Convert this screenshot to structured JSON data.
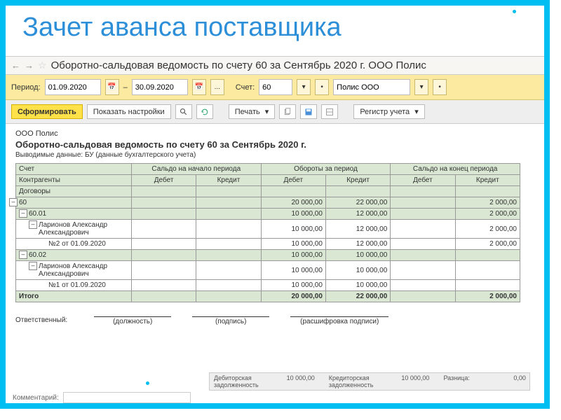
{
  "slide_title": "Зачет аванса поставщика",
  "window": {
    "title": "Оборотно-сальдовая ведомость по счету 60 за Сентябрь 2020 г. ООО Полис"
  },
  "filters": {
    "period_label": "Период:",
    "date_from": "01.09.2020",
    "date_dash": "–",
    "date_to": "30.09.2020",
    "account_label": "Счет:",
    "account": "60",
    "org": "Полис ООО"
  },
  "toolbar": {
    "form": "Сформировать",
    "settings": "Показать настройки",
    "print": "Печать",
    "register": "Регистр учета"
  },
  "report": {
    "org": "ООО Полис",
    "title": "Оборотно-сальдовая ведомость по счету 60 за Сентябрь 2020 г.",
    "subtitle": "Выводимые данные: БУ (данные бухгалтерского учета)",
    "headers": {
      "account": "Счет",
      "counterparties": "Контрагенты",
      "contracts": "Договоры",
      "start": "Сальдо на начало периода",
      "turnover": "Обороты за период",
      "end": "Сальдо на конец периода",
      "debit": "Дебет",
      "credit": "Кредит"
    },
    "rows": [
      {
        "name": "60",
        "sd": "",
        "sc": "",
        "td": "20 000,00",
        "tc": "22 000,00",
        "ed": "",
        "ec": "2 000,00",
        "cls": "gr",
        "ind": 0
      },
      {
        "name": "60.01",
        "sd": "",
        "sc": "",
        "td": "10 000,00",
        "tc": "12 000,00",
        "ed": "",
        "ec": "2 000,00",
        "cls": "gr",
        "ind": 1
      },
      {
        "name": "Ларионов Александр Александрович",
        "sd": "",
        "sc": "",
        "td": "10 000,00",
        "tc": "12 000,00",
        "ed": "",
        "ec": "2 000,00",
        "cls": "",
        "ind": 2
      },
      {
        "name": "№2 от 01.09.2020",
        "sd": "",
        "sc": "",
        "td": "10 000,00",
        "tc": "12 000,00",
        "ed": "",
        "ec": "2 000,00",
        "cls": "",
        "ind": 3
      },
      {
        "name": "60.02",
        "sd": "",
        "sc": "",
        "td": "10 000,00",
        "tc": "10 000,00",
        "ed": "",
        "ec": "",
        "cls": "gr",
        "ind": 1
      },
      {
        "name": "Ларионов Александр Александрович",
        "sd": "",
        "sc": "",
        "td": "10 000,00",
        "tc": "10 000,00",
        "ed": "",
        "ec": "",
        "cls": "",
        "ind": 2
      },
      {
        "name": "№1 от 01.09.2020",
        "sd": "",
        "sc": "",
        "td": "10 000,00",
        "tc": "10 000,00",
        "ed": "",
        "ec": "",
        "cls": "",
        "ind": 3
      }
    ],
    "total_label": "Итого",
    "total": {
      "sd": "",
      "sc": "",
      "td": "20 000,00",
      "tc": "22 000,00",
      "ed": "",
      "ec": "2 000,00"
    }
  },
  "signatures": {
    "resp": "Ответственный:",
    "pos": "(должность)",
    "sign": "(подпись)",
    "decode": "(расшифровка подписи)"
  },
  "status": {
    "deb_label": "Дебиторская задолженность",
    "deb": "10 000,00",
    "cred_label": "Кредиторская задолженность",
    "cred": "10 000,00",
    "diff_label": "Разница:",
    "diff": "0,00"
  },
  "comment_label": "Комментарий:"
}
